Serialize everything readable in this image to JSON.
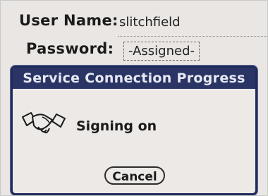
{
  "login": {
    "username_label": "User Name:",
    "username_value": "slitchfield",
    "password_label": "Password:",
    "password_value": "-Assigned-"
  },
  "dialog": {
    "title": "Service Connection Progress",
    "icon": "handshake-icon",
    "status": "Signing on",
    "cancel_label": "Cancel",
    "title_bar_color": "#2a3566"
  }
}
